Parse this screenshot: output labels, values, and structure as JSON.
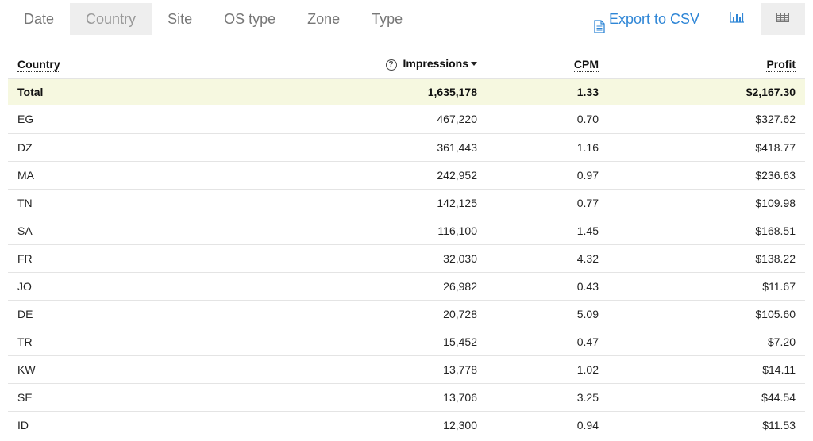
{
  "tabs": [
    "Date",
    "Country",
    "Site",
    "OS type",
    "Zone",
    "Type"
  ],
  "active_tab": "Country",
  "export_label": "Export to CSV",
  "accent_color": "#2f86d6",
  "total_row_color": "#f6f8e0",
  "headers": {
    "country": "Country",
    "impressions": "Impressions",
    "cpm": "CPM",
    "profit": "Profit"
  },
  "total": {
    "label": "Total",
    "impressions": "1,635,178",
    "cpm": "1.33",
    "profit": "$2,167.30"
  },
  "rows": [
    {
      "country": "EG",
      "impressions": "467,220",
      "cpm": "0.70",
      "profit": "$327.62"
    },
    {
      "country": "DZ",
      "impressions": "361,443",
      "cpm": "1.16",
      "profit": "$418.77"
    },
    {
      "country": "MA",
      "impressions": "242,952",
      "cpm": "0.97",
      "profit": "$236.63"
    },
    {
      "country": "TN",
      "impressions": "142,125",
      "cpm": "0.77",
      "profit": "$109.98"
    },
    {
      "country": "SA",
      "impressions": "116,100",
      "cpm": "1.45",
      "profit": "$168.51"
    },
    {
      "country": "FR",
      "impressions": "32,030",
      "cpm": "4.32",
      "profit": "$138.22"
    },
    {
      "country": "JO",
      "impressions": "26,982",
      "cpm": "0.43",
      "profit": "$11.67"
    },
    {
      "country": "DE",
      "impressions": "20,728",
      "cpm": "5.09",
      "profit": "$105.60"
    },
    {
      "country": "TR",
      "impressions": "15,452",
      "cpm": "0.47",
      "profit": "$7.20"
    },
    {
      "country": "KW",
      "impressions": "13,778",
      "cpm": "1.02",
      "profit": "$14.11"
    },
    {
      "country": "SE",
      "impressions": "13,706",
      "cpm": "3.25",
      "profit": "$44.54"
    },
    {
      "country": "ID",
      "impressions": "12,300",
      "cpm": "0.94",
      "profit": "$11.53"
    }
  ],
  "icons": {
    "export": "document-icon",
    "chart_view": "bar-chart-icon",
    "table_view": "table-icon",
    "help": "help-icon",
    "sort": "sort-desc-icon"
  }
}
